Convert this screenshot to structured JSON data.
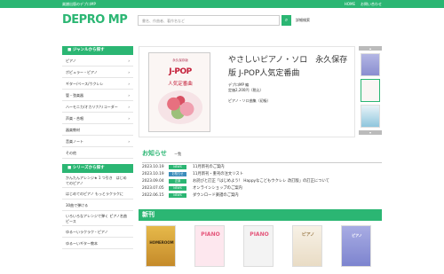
{
  "topbar": {
    "tagline": "楽譜出版のデプロMP",
    "links": [
      "HOME",
      "お問い合わせ"
    ]
  },
  "header": {
    "logo": "DEPRO MP",
    "search_placeholder": "書名、作曲者、著作名など",
    "search_button_icon": "search-icon",
    "advanced_search": "詳細検索"
  },
  "sidebar": {
    "genre_heading": "ジャンルから探す",
    "genres": [
      "ピアノ",
      "ポピュラー・ピアノ",
      "ギター/ベース/ウクレレ",
      "管・弦楽器",
      "ハーモニカ/オカリナ/リコーダー",
      "声楽・合唱",
      "器楽教材",
      "音楽ノート",
      "その他"
    ],
    "series_heading": "シリーズから探す",
    "series": [
      "かんたんアレンジ★ 1 つ引き　はじめてのピアノ",
      "はじめてのピアノ もっとラクラクに",
      "30曲で弾ける",
      "いろいろなアレンジで弾く ピアノ名曲ピース",
      "ゆるーいラクラク・ピアノ",
      "ゆるーいギター教本"
    ]
  },
  "feature": {
    "cover": {
      "top": "永久保存版",
      "title": "J-POP",
      "subtitle": "人気定番曲"
    },
    "title": "やさしいピアノ・ソロ　永久保存版 J-POP人気定番曲",
    "publisher": "デプロMP 編",
    "price": "定価2,200円（税込）",
    "series_name": "ピアノ・ソロ曲集（初級）"
  },
  "news": {
    "heading": "お知らせ",
    "list_link": "一覧",
    "items": [
      {
        "date": "2023.10.19",
        "badge": "NEWS",
        "text": "11月新刊のご案内"
      },
      {
        "date": "2023.10.19",
        "badge": "お知らせ",
        "text": "11月新刊・重刊の注文リスト"
      },
      {
        "date": "2023.09.04",
        "badge": "正誤",
        "text": "お詫びと訂正「はじめよう！ Happyなこどもウクレレ 改訂版」の訂正について"
      },
      {
        "date": "2023.07.05",
        "badge": "NEWS",
        "text": "オンラインショップのご案内"
      },
      {
        "date": "2022.06.15",
        "badge": "NEWS",
        "text": "ダウンロード楽譜のご案内"
      }
    ]
  },
  "new_releases": {
    "heading": "新刊",
    "books": [
      "HOMEROOM",
      "PIANO",
      "PIANO",
      "ピアノ",
      "ピアノ"
    ]
  },
  "colors": {
    "accent": "#2bb673",
    "badge_blue": "#3c8dbc"
  }
}
